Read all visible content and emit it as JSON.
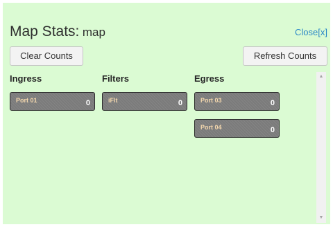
{
  "title": {
    "main": "Map Stats:",
    "sub": "map"
  },
  "close_label": "Close[x]",
  "buttons": {
    "clear": "Clear Counts",
    "refresh": "Refresh Counts"
  },
  "columns": {
    "ingress": {
      "header": "Ingress",
      "items": [
        {
          "label": "Port 01",
          "count": "0"
        }
      ]
    },
    "filters": {
      "header": "Filters",
      "items": [
        {
          "label": "iFlt",
          "count": "0"
        }
      ]
    },
    "egress": {
      "header": "Egress",
      "items": [
        {
          "label": "Port 03",
          "count": "0"
        },
        {
          "label": "Port 04",
          "count": "0"
        }
      ]
    }
  },
  "scrollbar": {
    "up_icon": "▲",
    "down_icon": "▼"
  },
  "colors": {
    "panel_bg": "#dbfbd3",
    "link": "#2a87c7",
    "port_bg": "#7b7b7b",
    "port_label": "#f3d7ad"
  }
}
